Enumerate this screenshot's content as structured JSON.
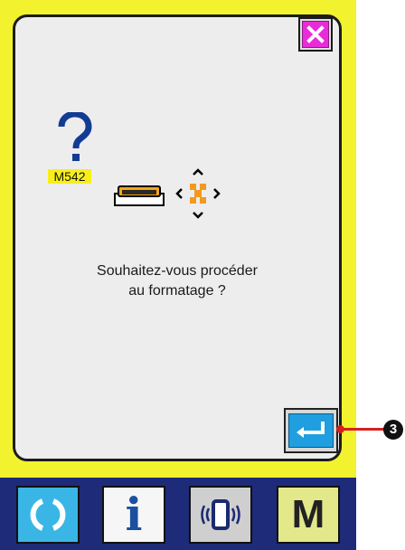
{
  "dialog": {
    "message_code": "M542",
    "message_lines": [
      "Souhaitez-vous procéder",
      "au formatage ?"
    ],
    "icons": {
      "question": "question-mark-icon",
      "media": "usb-media-icon",
      "move": "move-arrows-icon"
    },
    "close_icon": "close-icon",
    "enter_icon": "enter-icon"
  },
  "callout": {
    "number": "3"
  },
  "bottom_bar": {
    "buttons": [
      {
        "name": "reset",
        "icon": "reset-icon"
      },
      {
        "name": "information",
        "icon": "info-icon",
        "label": "i"
      },
      {
        "name": "communication",
        "icon": "communication-icon"
      },
      {
        "name": "mode",
        "icon": "mode-icon",
        "label": "M"
      }
    ]
  },
  "colors": {
    "background": "#f2f22e",
    "dialog": "#ededed",
    "close_button": "#e82cd8",
    "enter_button": "#1f9fe0",
    "code_badge": "#f7ef1a",
    "bottom_bar": "#1e2b78",
    "callout": "#d41f1f"
  }
}
